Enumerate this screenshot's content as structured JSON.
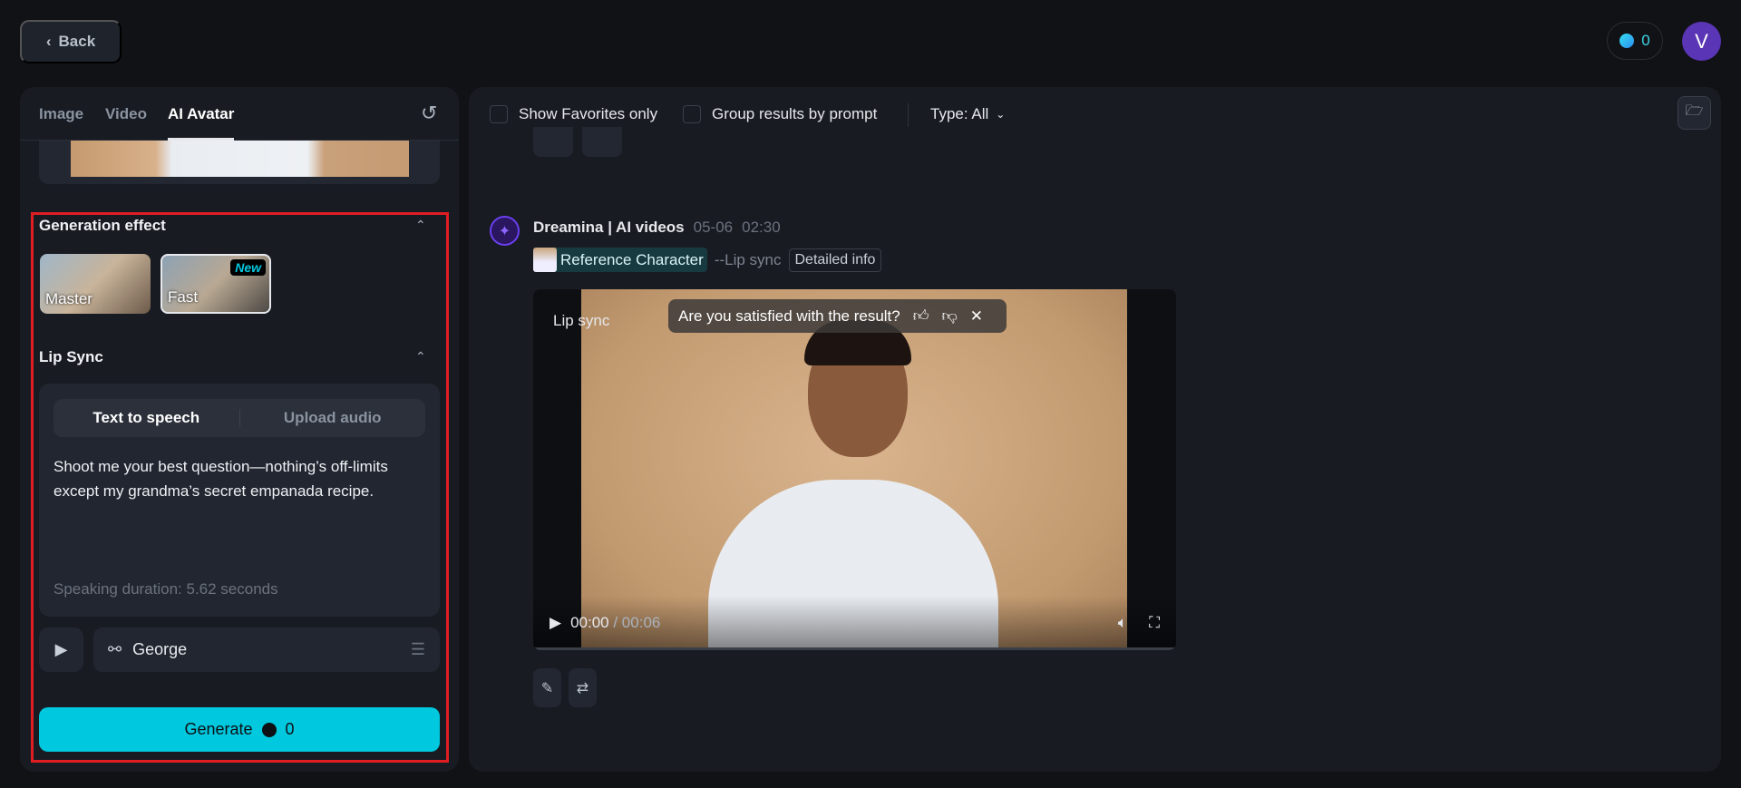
{
  "header": {
    "back_label": "Back",
    "credits": "0",
    "avatar_initial": "V"
  },
  "left": {
    "tabs": [
      {
        "label": "Image"
      },
      {
        "label": "Video"
      },
      {
        "label": "AI Avatar"
      }
    ],
    "generation_effect": {
      "title": "Generation effect",
      "options": [
        {
          "label": "Master"
        },
        {
          "label": "Fast",
          "badge": "New"
        }
      ]
    },
    "lip_sync": {
      "title": "Lip Sync",
      "modes": [
        "Text to speech",
        "Upload audio"
      ],
      "text": "Shoot me your best question—nothing’s off-limits except my grandma’s secret empanada recipe.",
      "duration": "Speaking duration: 5.62 seconds",
      "voice": "George"
    },
    "generate": {
      "label": "Generate",
      "cost": "0"
    }
  },
  "right": {
    "toolbar": {
      "favorites": "Show Favorites only",
      "group": "Group results by prompt",
      "type": "Type: All"
    },
    "result": {
      "title": "Dreamina | AI videos",
      "date": "05-06",
      "time": "02:30",
      "ref": "Reference Character",
      "mode": "--Lip sync",
      "info": "Detailed info",
      "video_label": "Lip sync",
      "feedback": "Are you satisfied with the result?",
      "current": "00:00",
      "total": "/ 00:06"
    }
  },
  "colors": {
    "accent": "#00c8de",
    "highlight": "#e11d24",
    "avatar": "#5a35b5"
  }
}
